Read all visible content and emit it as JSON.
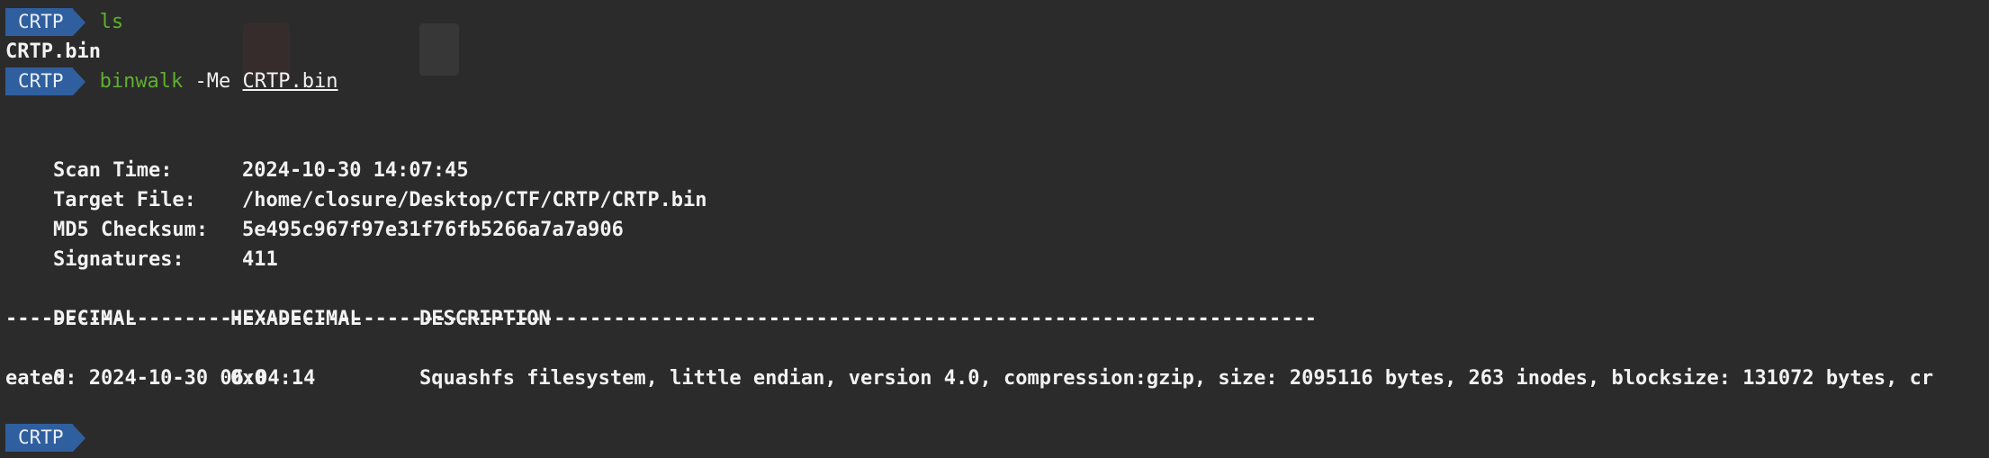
{
  "prompt_label": "CRTP",
  "lines": {
    "cmd1": "ls",
    "ls_output": "CRTP.bin",
    "cmd2_name": "binwalk",
    "cmd2_flag": "-Me",
    "cmd2_arg": "CRTP.bin"
  },
  "scan_info": {
    "scan_time_label": "Scan Time:",
    "scan_time_value": "2024-10-30 14:07:45",
    "target_label": "Target File:",
    "target_value": "/home/closure/Desktop/CTF/CRTP/CRTP.bin",
    "md5_label": "MD5 Checksum:",
    "md5_value": "5e495c967f97e31f76fb5266a7a7a906",
    "signatures_label": "Signatures:",
    "signatures_value": "411"
  },
  "results_table": {
    "headers": [
      "DECIMAL",
      "HEXADECIMAL",
      "DESCRIPTION"
    ],
    "separator": "--------------------------------------------------------------------------------------------------------------",
    "rows": [
      {
        "decimal": "0",
        "hex": "0x0",
        "description_line1": "Squashfs filesystem, little endian, version 4.0, compression:gzip, size: 2095116 bytes, 263 inodes, blocksize: 131072 bytes, cr",
        "description_line2": "eated: 2024-10-30 06:04:14"
      }
    ]
  },
  "colors": {
    "background": "#2b2b2b",
    "prompt_badge": "#2f5f9e",
    "command_green": "#5faf2f",
    "text": "#f2f2f2"
  }
}
